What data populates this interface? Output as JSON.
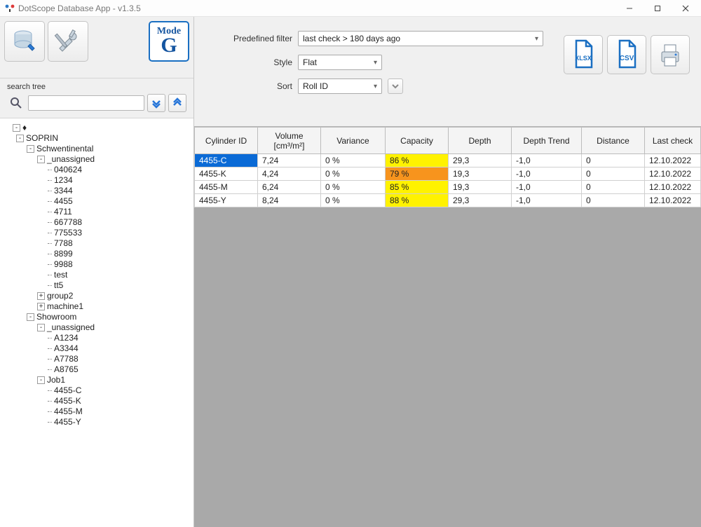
{
  "window": {
    "title": "DotScope Database App - v1.3.5"
  },
  "left_toolbar": {
    "db_tooltip": "Database",
    "tools_tooltip": "Tools",
    "mode_label": "Mode",
    "mode_letter": "G"
  },
  "search_tree": {
    "label": "search tree",
    "input_value": ""
  },
  "tree": {
    "root": "♦",
    "nodes": [
      {
        "label": "SOPRIN",
        "level": 1,
        "exp": "-"
      },
      {
        "label": "Schwentinental",
        "level": 2,
        "exp": "-"
      },
      {
        "label": "_unassigned",
        "level": 3,
        "exp": "-"
      },
      {
        "label": "040624",
        "level": 4
      },
      {
        "label": "1234",
        "level": 4
      },
      {
        "label": "3344",
        "level": 4
      },
      {
        "label": "4455",
        "level": 4
      },
      {
        "label": "4711",
        "level": 4
      },
      {
        "label": "667788",
        "level": 4
      },
      {
        "label": "775533",
        "level": 4
      },
      {
        "label": "7788",
        "level": 4
      },
      {
        "label": "8899",
        "level": 4
      },
      {
        "label": "9988",
        "level": 4
      },
      {
        "label": "test",
        "level": 4
      },
      {
        "label": "tt5",
        "level": 4
      },
      {
        "label": "group2",
        "level": 3,
        "exp": "+"
      },
      {
        "label": "machine1",
        "level": 3,
        "exp": "+"
      },
      {
        "label": "Showroom",
        "level": 2,
        "exp": "-"
      },
      {
        "label": "_unassigned",
        "level": 3,
        "exp": "-"
      },
      {
        "label": "A1234",
        "level": 4
      },
      {
        "label": "A3344",
        "level": 4
      },
      {
        "label": "A7788",
        "level": 4
      },
      {
        "label": "A8765",
        "level": 4
      },
      {
        "label": "Job1",
        "level": 3,
        "exp": "-"
      },
      {
        "label": "4455-C",
        "level": 4
      },
      {
        "label": "4455-K",
        "level": 4
      },
      {
        "label": "4455-M",
        "level": 4
      },
      {
        "label": "4455-Y",
        "level": 4
      }
    ]
  },
  "filters": {
    "predefined_label": "Predefined filter",
    "predefined_value": "last check > 180 days ago",
    "style_label": "Style",
    "style_value": "Flat",
    "sort_label": "Sort",
    "sort_value": "Roll ID"
  },
  "export": {
    "xlsx_label": "XLSX",
    "csv_label": "CSV"
  },
  "table": {
    "columns": [
      "Cylinder ID",
      "Volume [cm³/m²]",
      "Variance",
      "Capacity",
      "Depth",
      "Depth Trend",
      "Distance",
      "Last check"
    ],
    "rows": [
      {
        "selected": true,
        "id": "4455-C",
        "volume": "7,24",
        "variance": "0 %",
        "capacity": "86 %",
        "cap_class": "yellow",
        "depth": "29,3",
        "trend": "-1,0",
        "distance": "0",
        "last": "12.10.2022"
      },
      {
        "selected": false,
        "id": "4455-K",
        "volume": "4,24",
        "variance": "0 %",
        "capacity": "79 %",
        "cap_class": "orange",
        "depth": "19,3",
        "trend": "-1,0",
        "distance": "0",
        "last": "12.10.2022"
      },
      {
        "selected": false,
        "id": "4455-M",
        "volume": "6,24",
        "variance": "0 %",
        "capacity": "85 %",
        "cap_class": "yellow",
        "depth": "19,3",
        "trend": "-1,0",
        "distance": "0",
        "last": "12.10.2022"
      },
      {
        "selected": false,
        "id": "4455-Y",
        "volume": "8,24",
        "variance": "0 %",
        "capacity": "88 %",
        "cap_class": "yellow",
        "depth": "29,3",
        "trend": "-1,0",
        "distance": "0",
        "last": "12.10.2022"
      }
    ]
  }
}
